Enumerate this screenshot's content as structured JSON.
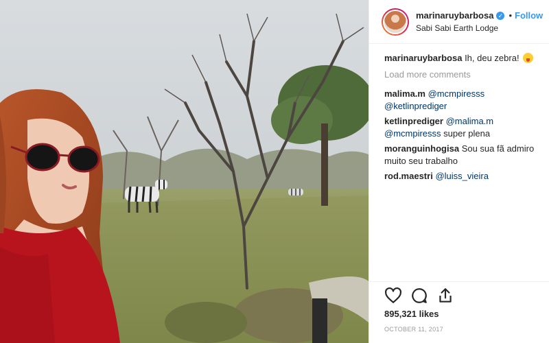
{
  "post": {
    "username": "marinaruybarbosa",
    "follow_label": "Follow",
    "location": "Sabi Sabi Earth Lodge",
    "caption_user": "marinaruybarbosa",
    "caption_text": "Ih, deu zebra!",
    "load_more": "Load more comments",
    "comments": [
      {
        "user": "malima.m",
        "text": "",
        "mentions": [
          "@mcmpiresss",
          "@ketlinprediger"
        ]
      },
      {
        "user": "ketlinprediger",
        "text": "super plena",
        "mentions": [
          "@malima.m",
          "@mcmpiresss"
        ]
      },
      {
        "user": "moranguinhogisa",
        "text": "Sou sua fã admiro muito seu trabalho",
        "mentions": []
      },
      {
        "user": "rod.maestri",
        "text": "",
        "mentions": [
          "@luiss_vieira"
        ]
      }
    ],
    "likes": "895,321 likes",
    "date": "OCTOBER 11, 2017"
  },
  "icons": {
    "verified": "verified-badge-icon",
    "like": "heart-icon",
    "comment": "comment-bubble-icon",
    "share": "share-icon"
  },
  "colors": {
    "link_blue": "#3897f0",
    "mention": "#003569",
    "muted": "#999999"
  }
}
